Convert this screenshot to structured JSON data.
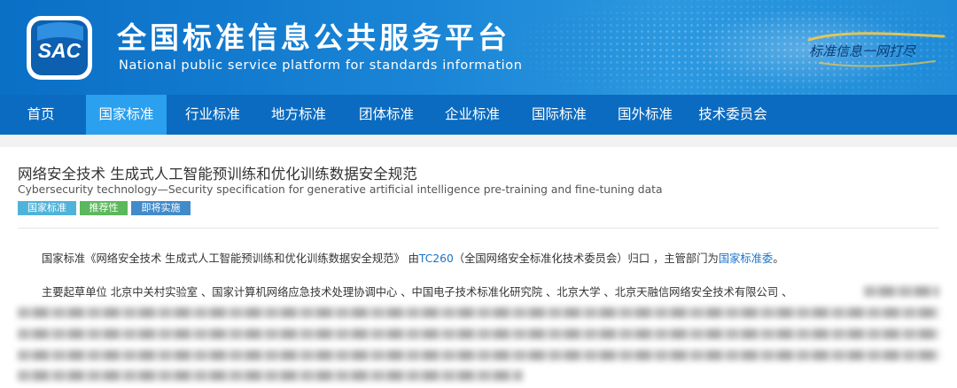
{
  "header": {
    "logo_text": "SAC",
    "title_cn": "全国标准信息公共服务平台",
    "title_en": "National public service platform  for standards information",
    "slogan": "标准信息一网打尽"
  },
  "nav": {
    "items": [
      {
        "label": "首页"
      },
      {
        "label": "国家标准"
      },
      {
        "label": "行业标准"
      },
      {
        "label": "地方标准"
      },
      {
        "label": "团体标准"
      },
      {
        "label": "企业标准"
      },
      {
        "label": "国际标准"
      },
      {
        "label": "国外标准"
      },
      {
        "label": "技术委员会"
      }
    ],
    "active": "国家标准"
  },
  "standard": {
    "title_cn": "网络安全技术  生成式人工智能预训练和优化训练数据安全规范",
    "title_en": "Cybersecurity technology—Security specification for generative artificial intelligence pre-training and fine-tuning data",
    "tags": [
      {
        "label": "国家标准",
        "color": "#4fb3d9"
      },
      {
        "label": "推荐性",
        "color": "#5cb85c"
      },
      {
        "label": "即将实施",
        "color": "#428bca"
      }
    ],
    "summary": {
      "prefix": "国家标准《网络安全技术  生成式人工智能预训练和优化训练数据安全规范》 由",
      "tc_link": "TC260",
      "middle": "（全国网络安全标准化技术委员会）归口 ，主管部门为",
      "dept_link": "国家标准委",
      "suffix": "。"
    },
    "drafters": {
      "label": "主要起草单位",
      "text": " 北京中关村实验室 、国家计算机网络应急技术处理协调中心 、中国电子技术标准化研究院 、北京大学 、北京天融信网络安全技术有限公司 、"
    }
  },
  "colors": {
    "nav_bg": "#0b6bc0",
    "nav_active": "#2aa0ee",
    "link": "#1a73c7"
  }
}
